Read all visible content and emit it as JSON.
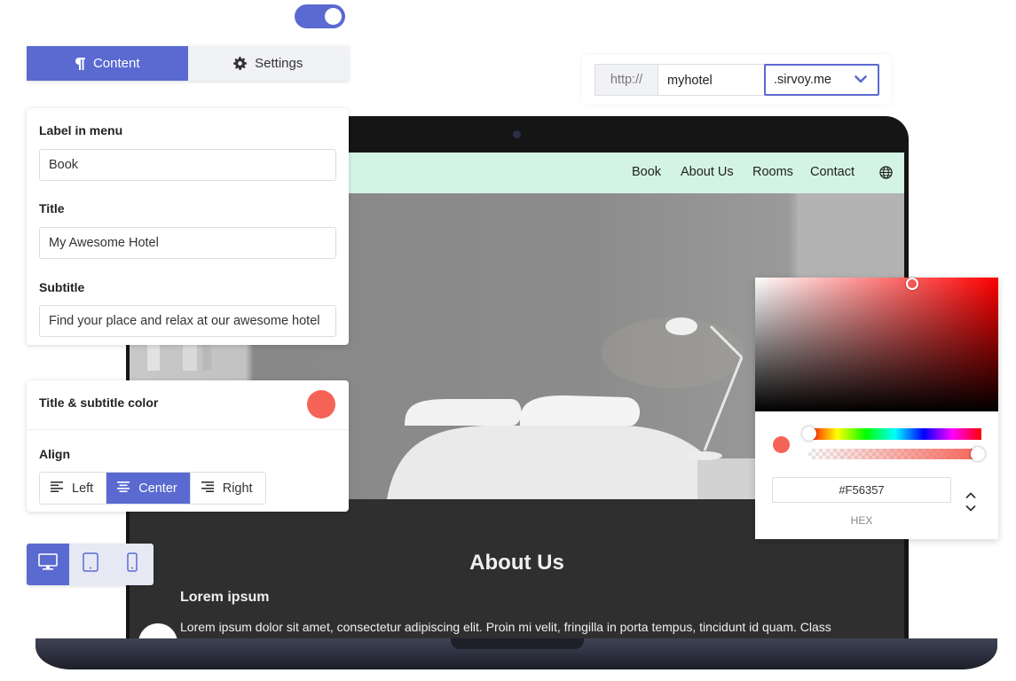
{
  "tabs": {
    "content_label": "Content",
    "settings_label": "Settings"
  },
  "content_panel": {
    "menu_label": "Label in menu",
    "menu_value": "Book",
    "title_label": "Title",
    "title_value": "My Awesome Hotel",
    "subtitle_label": "Subtitle",
    "subtitle_value": "Find your place and relax at our awesome hotel"
  },
  "style_panel": {
    "color_label": "Title & subtitle color",
    "color_value": "#F56357",
    "align_label": "Align",
    "align_options": [
      "Left",
      "Center",
      "Right"
    ],
    "align_selected": "Center"
  },
  "devices": [
    "desktop-icon",
    "tablet-icon",
    "mobile-icon"
  ],
  "url": {
    "protocol": "http://",
    "subdomain": "myhotel",
    "domain": ".sirvoy.me"
  },
  "site": {
    "nav": [
      "Book",
      "About Us",
      "Rooms",
      "Contact"
    ],
    "about_title": "About Us",
    "lorem_heading": "Lorem ipsum",
    "lorem_text": "Lorem ipsum dolor sit amet, consectetur adipiscing elit. Proin mi velit, fringilla in porta tempus, tincidunt id quam. Class"
  },
  "picker": {
    "hex_value": "#F56357",
    "mode_label": "HEX"
  },
  "colors": {
    "accent": "#5a6ad0",
    "nav_bg": "#d3f3e5",
    "selected_color": "#f56357"
  }
}
